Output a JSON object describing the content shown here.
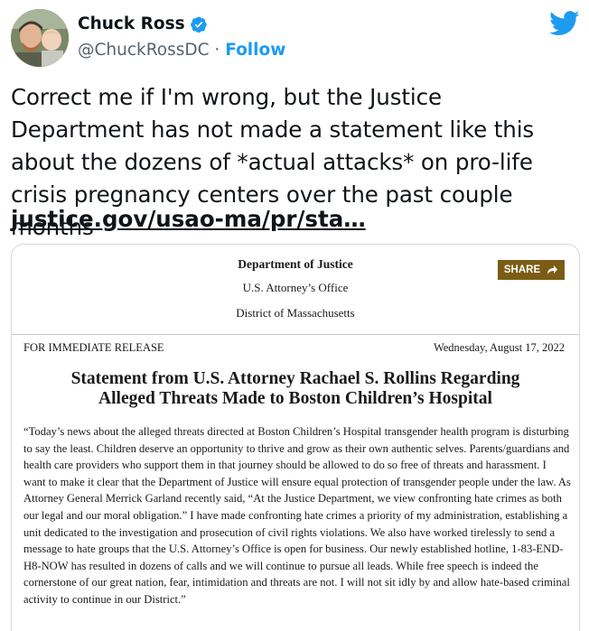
{
  "author": {
    "display_name": "Chuck Ross",
    "handle": "@ChuckRossDC",
    "separator": " · ",
    "follow_label": "Follow",
    "verified_icon": "verified-badge-icon",
    "verified_color": "#1d9bf0"
  },
  "brand": {
    "icon": "twitter-bird-icon",
    "color": "#1d9bf0"
  },
  "tweet": {
    "text": "Correct me if I'm wrong, but the Justice Department has not made a statement like this about the dozens of *actual attacks* on pro-life crisis pregnancy centers over the past couple months",
    "link": "justice.gov/usao-ma/pr/sta…"
  },
  "embedded_image": {
    "header_line1": "Department of Justice",
    "header_line2": "U.S. Attorney’s Office",
    "header_line3": "District of Massachusetts",
    "share_label": "SHARE",
    "share_color": "#7a5c14",
    "release_label": "FOR IMMEDIATE RELEASE",
    "release_date": "Wednesday, August 17, 2022",
    "headline_line1": "Statement from U.S. Attorney Rachael S. Rollins Regarding",
    "headline_line2": "Alleged Threats Made to Boston Children’s Hospital",
    "body": "“Today’s news about the alleged threats directed at Boston Children’s Hospital transgender health program is disturbing to say the least.  Children deserve an opportunity to thrive and grow as their own authentic selves. Parents/guardians and health care providers who support them in that journey should be allowed to do so free of threats and harassment.  I want to make it clear that the Department of Justice will ensure equal protection of transgender people under the law. As Attorney General Merrick Garland recently said, “At the Justice Department, we view confronting hate crimes as both our legal and our moral obligation.” I have made confronting hate crimes a priority of my administration, establishing a unit dedicated to the investigation and prosecution of civil rights violations. We also have worked tirelessly to send a message to hate groups that the U.S. Attorney’s Office is open for business. Our newly established hotline, 1-83-END-H8-NOW has resulted in dozens of calls and we will continue to pursue all leads. While free speech is indeed the cornerstone of our great nation, fear, intimidation and threats are not. I will not sit idly by and allow hate-based criminal activity to continue in our District.”"
  }
}
